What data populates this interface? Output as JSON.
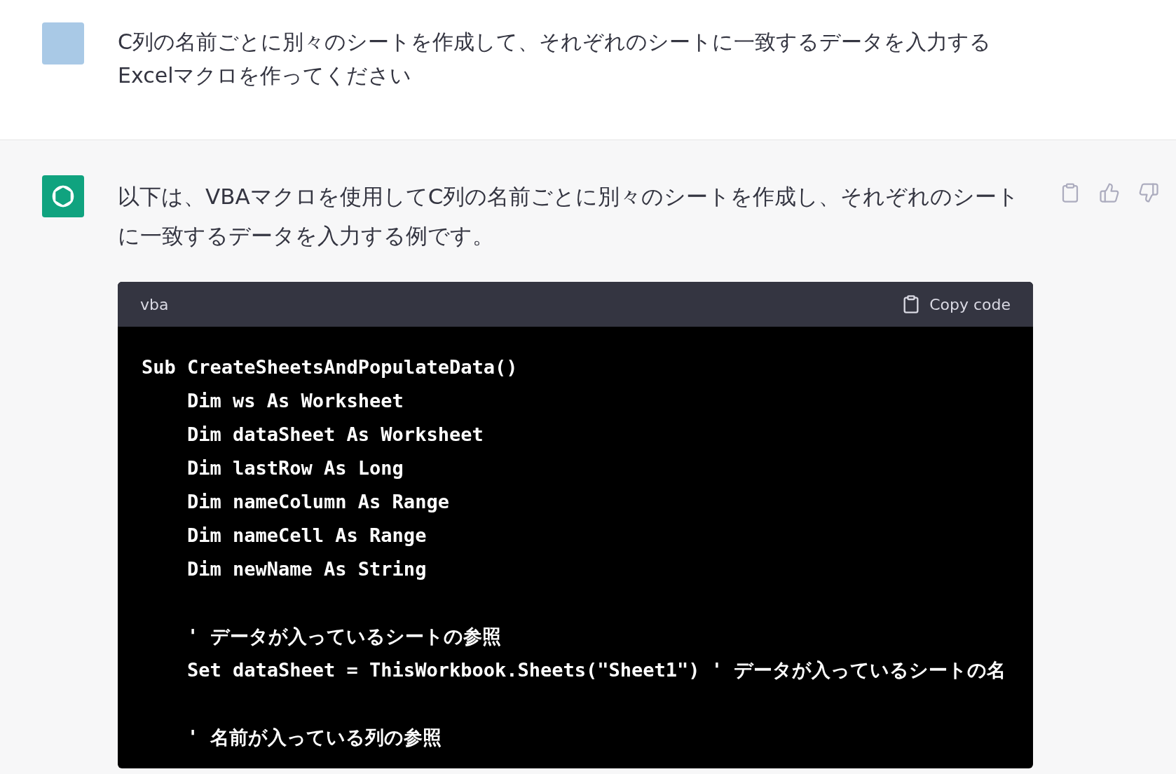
{
  "user_message": {
    "text": "C列の名前ごとに別々のシートを作成して、それぞれのシートに一致するデータを入力するExcelマクロを作ってください"
  },
  "assistant_message": {
    "text": "以下は、VBAマクロを使用してC列の名前ごとに別々のシートを作成し、それぞれのシートに一致するデータを入力する例です。",
    "code_block": {
      "language": "vba",
      "copy_label": "Copy code",
      "blocks": [
        [
          "Sub CreateSheetsAndPopulateData()",
          "    Dim ws As Worksheet",
          "    Dim dataSheet As Worksheet",
          "    Dim lastRow As Long",
          "    Dim nameColumn As Range",
          "    Dim nameCell As Range",
          "    Dim newName As String"
        ],
        [
          "    ' データが入っているシートの参照",
          "    Set dataSheet = ThisWorkbook.Sheets(\"Sheet1\") ' データが入っているシートの名"
        ],
        [
          "    ' 名前が入っている列の参照"
        ]
      ]
    }
  }
}
